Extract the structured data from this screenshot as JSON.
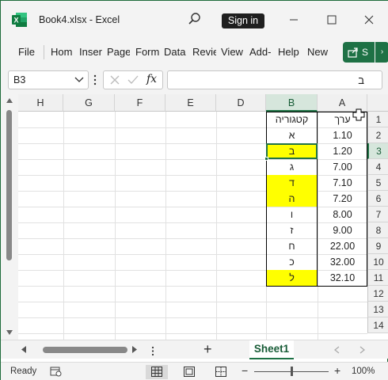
{
  "window": {
    "title": "Book4.xlsx  -  Excel",
    "signin_label": "Sign in"
  },
  "ribbon": {
    "tabs": [
      "File",
      "Hom",
      "Inser",
      "Page",
      "Form",
      "Data",
      "Revie",
      "View",
      "Add-",
      "Help",
      "New"
    ],
    "share_label": "S"
  },
  "formula_bar": {
    "name_box": "B3",
    "fx_label": "fx",
    "content": "ב"
  },
  "grid": {
    "columns": [
      "H",
      "G",
      "F",
      "E",
      "D",
      "B",
      "A"
    ],
    "rows": [
      "1",
      "2",
      "3",
      "4",
      "5",
      "6",
      "7",
      "8",
      "9",
      "10",
      "11",
      "12",
      "13",
      "14"
    ],
    "selected_cell": "B3",
    "headers": {
      "B": "קטגוריה",
      "A": "ערך"
    },
    "data": [
      {
        "category": "א",
        "value": "1.10",
        "highlight": false
      },
      {
        "category": "ב",
        "value": "1.20",
        "highlight": true
      },
      {
        "category": "ג",
        "value": "7.00",
        "highlight": false
      },
      {
        "category": "ד",
        "value": "7.10",
        "highlight": true
      },
      {
        "category": "ה",
        "value": "7.20",
        "highlight": true
      },
      {
        "category": "ו",
        "value": "8.00",
        "highlight": false
      },
      {
        "category": "ז",
        "value": "9.00",
        "highlight": false
      },
      {
        "category": "ח",
        "value": "22.00",
        "highlight": false
      },
      {
        "category": "כ",
        "value": "32.00",
        "highlight": false
      },
      {
        "category": "ל",
        "value": "32.10",
        "highlight": true
      }
    ],
    "highlight_color": "#ffff00"
  },
  "sheets": {
    "tabs": [
      "Sheet1"
    ],
    "add_label": "+"
  },
  "status": {
    "ready": "Ready",
    "zoom_minus": "−",
    "zoom_plus": "+",
    "zoom": "100%"
  },
  "colors": {
    "accent": "#217346",
    "brand": "#1e7145"
  }
}
